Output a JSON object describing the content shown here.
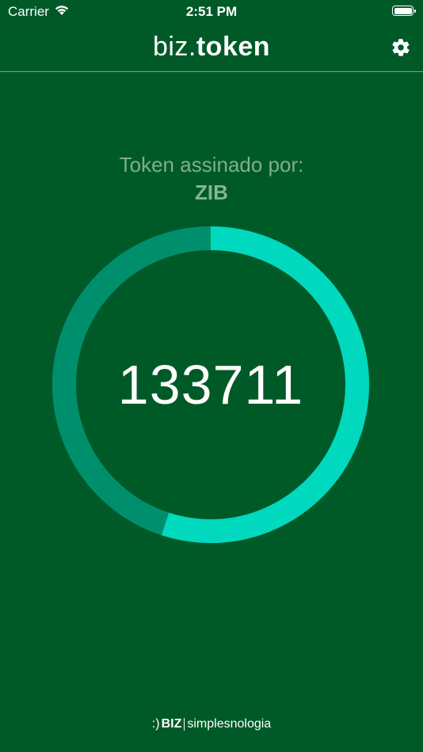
{
  "status_bar": {
    "carrier": "Carrier",
    "time": "2:51 PM",
    "wifi_icon": "wifi-icon",
    "battery_icon": "battery-full-icon"
  },
  "header": {
    "brand_light": "biz.",
    "brand_bold": "token",
    "settings_icon": "gear-icon"
  },
  "token": {
    "signed_by_label": "Token assinado por:",
    "issuer": "ZIB",
    "code": "133711",
    "time_remaining_fraction": 0.55
  },
  "colors": {
    "background": "#005a27",
    "ring_active": "#00d9bd",
    "ring_track": "#008f6c"
  },
  "footer": {
    "logo_prefix": ":)",
    "logo_brand": "BIZ",
    "logo_tagline": "simplesnologia"
  }
}
